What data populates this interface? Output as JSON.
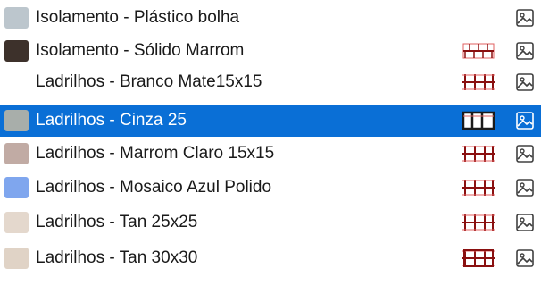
{
  "materials": [
    {
      "name": "Isolamento - Plástico bolha",
      "color": "#bcc6cd",
      "pattern": "none",
      "selected": false
    },
    {
      "name": "Isolamento - Sólido Marrom",
      "color": "#3d312b",
      "pattern": "insulation-hatch",
      "selected": false
    },
    {
      "name": "Ladrilhos - Branco Mate15x15",
      "color": null,
      "pattern": "tile-grid",
      "selected": false
    },
    {
      "name": "Ladrilhos - Cinza 25",
      "color": "#a8aeaa",
      "pattern": "tile-grid-bold",
      "selected": true
    },
    {
      "name": "Ladrilhos - Marrom Claro 15x15",
      "color": "#c1aba4",
      "pattern": "tile-grid",
      "selected": false
    },
    {
      "name": "Ladrilhos - Mosaico Azul Polido",
      "color": "#7fa6ee",
      "pattern": "tile-grid",
      "selected": false
    },
    {
      "name": "Ladrilhos - Tan 25x25",
      "color": "#e4d8cd",
      "pattern": "tile-grid",
      "selected": false
    },
    {
      "name": "Ladrilhos - Tan 30x30",
      "color": "#e0d3c6",
      "pattern": "tile-grid-box",
      "selected": false
    }
  ],
  "colors": {
    "selection": "#0a6fd6",
    "pattern_stroke": "#8a1010",
    "pattern_accent": "#e06060"
  },
  "icons": {
    "appearance": "image-icon"
  }
}
